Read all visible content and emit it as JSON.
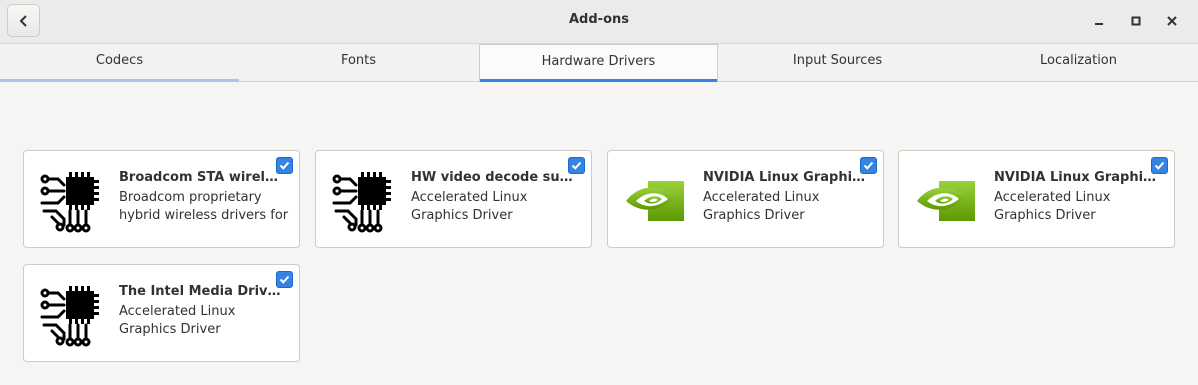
{
  "window": {
    "title": "Add-ons"
  },
  "colors": {
    "accent": "#3584e4",
    "nvidia_green": "#76b900"
  },
  "tabs": [
    {
      "label": "Codecs",
      "active": false
    },
    {
      "label": "Fonts",
      "active": false
    },
    {
      "label": "Hardware Drivers",
      "active": true
    },
    {
      "label": "Input Sources",
      "active": false
    },
    {
      "label": "Localization",
      "active": false
    }
  ],
  "cards": [
    {
      "title": "Broadcom STA wireless d...",
      "description": "Broadcom proprietary hybrid wireless drivers for ...",
      "icon": "chip-icon",
      "checked": true
    },
    {
      "title": "HW video decode suppor...",
      "description": "Accelerated Linux Graphics Driver",
      "icon": "chip-icon",
      "checked": true
    },
    {
      "title": "NVIDIA Linux Graphics D...",
      "description": "Accelerated Linux Graphics Driver",
      "icon": "nvidia-icon",
      "checked": true
    },
    {
      "title": "NVIDIA Linux Graphics D...",
      "description": "Accelerated Linux Graphics Driver",
      "icon": "nvidia-icon",
      "checked": true
    },
    {
      "title": "The Intel Media Driver f...",
      "description": "Accelerated Linux Graphics Driver",
      "icon": "chip-icon",
      "checked": true
    }
  ]
}
